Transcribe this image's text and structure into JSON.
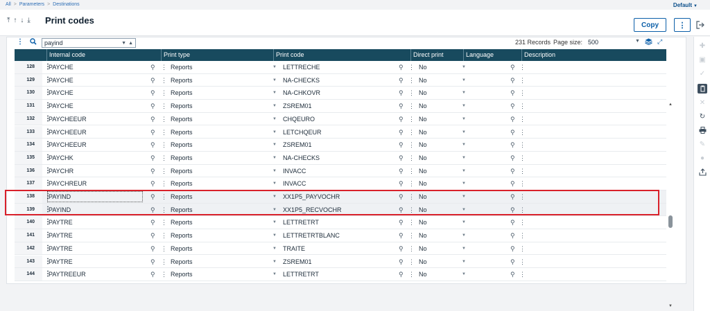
{
  "breadcrumb": [
    "All",
    "Parameters",
    "Destinations"
  ],
  "breadcrumb_sep": ">",
  "profile_menu": "Default",
  "page_title": "Print codes",
  "nav": {
    "first": "⤒",
    "prev": "↑",
    "next": "↓",
    "last": "⤓"
  },
  "copy_label": "Copy",
  "more_label": "⋮",
  "search": {
    "value": "payind"
  },
  "records": "231 Records",
  "page_size_label": "Page size:",
  "page_size_value": "500",
  "columns": [
    "Internal code",
    "Print type",
    "Print code",
    "Direct print",
    "Language",
    "Description"
  ],
  "rows": [
    {
      "num": "128",
      "internal_code": "PAYCHE",
      "print_type": "Reports",
      "print_code": "LETTRECHE",
      "direct_print": "No",
      "language": ""
    },
    {
      "num": "129",
      "internal_code": "PAYCHE",
      "print_type": "Reports",
      "print_code": "NA-CHECKS",
      "direct_print": "No",
      "language": ""
    },
    {
      "num": "130",
      "internal_code": "PAYCHE",
      "print_type": "Reports",
      "print_code": "NA-CHKOVR",
      "direct_print": "No",
      "language": ""
    },
    {
      "num": "131",
      "internal_code": "PAYCHE",
      "print_type": "Reports",
      "print_code": "ZSREM01",
      "direct_print": "No",
      "language": ""
    },
    {
      "num": "132",
      "internal_code": "PAYCHEEUR",
      "print_type": "Reports",
      "print_code": "CHQEURO",
      "direct_print": "No",
      "language": ""
    },
    {
      "num": "133",
      "internal_code": "PAYCHEEUR",
      "print_type": "Reports",
      "print_code": "LETCHQEUR",
      "direct_print": "No",
      "language": ""
    },
    {
      "num": "134",
      "internal_code": "PAYCHEEUR",
      "print_type": "Reports",
      "print_code": "ZSREM01",
      "direct_print": "No",
      "language": ""
    },
    {
      "num": "135",
      "internal_code": "PAYCHK",
      "print_type": "Reports",
      "print_code": "NA-CHECKS",
      "direct_print": "No",
      "language": ""
    },
    {
      "num": "136",
      "internal_code": "PAYCHR",
      "print_type": "Reports",
      "print_code": "INVACC",
      "direct_print": "No",
      "language": ""
    },
    {
      "num": "137",
      "internal_code": "PAYCHREUR",
      "print_type": "Reports",
      "print_code": "INVACC",
      "direct_print": "No",
      "language": ""
    },
    {
      "num": "138",
      "internal_code": "PAYIND",
      "print_type": "Reports",
      "print_code": "XX1P5_PAYVOCHR",
      "direct_print": "No",
      "language": ""
    },
    {
      "num": "139",
      "internal_code": "PAYIND",
      "print_type": "Reports",
      "print_code": "XX1P5_RECVOCHR",
      "direct_print": "No",
      "language": ""
    },
    {
      "num": "140",
      "internal_code": "PAYTRE",
      "print_type": "Reports",
      "print_code": "LETTRETRT",
      "direct_print": "No",
      "language": ""
    },
    {
      "num": "141",
      "internal_code": "PAYTRE",
      "print_type": "Reports",
      "print_code": "LETTRETRTBLANC",
      "direct_print": "No",
      "language": ""
    },
    {
      "num": "142",
      "internal_code": "PAYTRE",
      "print_type": "Reports",
      "print_code": "TRAITE",
      "direct_print": "No",
      "language": ""
    },
    {
      "num": "143",
      "internal_code": "PAYTRE",
      "print_type": "Reports",
      "print_code": "ZSREM01",
      "direct_print": "No",
      "language": ""
    },
    {
      "num": "144",
      "internal_code": "PAYTREEUR",
      "print_type": "Reports",
      "print_code": "LETTRETRT",
      "direct_print": "No",
      "language": ""
    }
  ],
  "highlighted_rows": [
    "138",
    "139"
  ],
  "colors": {
    "header_bg": "#184a5e",
    "accent": "#0a5ea8",
    "highlight_border": "#d9202a"
  }
}
